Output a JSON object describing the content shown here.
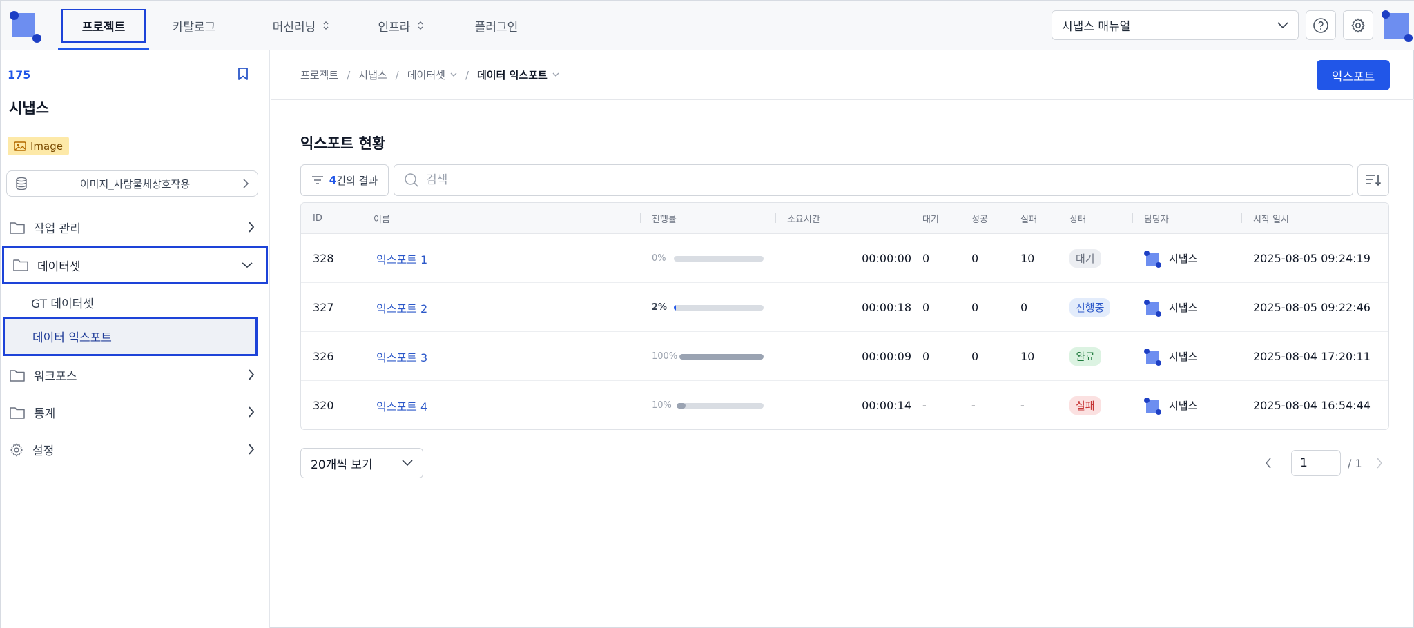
{
  "nav": {
    "tabs": [
      {
        "label": "프로젝트",
        "active": true
      },
      {
        "label": "카탈로그",
        "dropdown": false
      },
      {
        "label": "머신러닝",
        "dropdown": true
      },
      {
        "label": "인프라",
        "dropdown": true
      },
      {
        "label": "플러그인",
        "dropdown": false
      }
    ],
    "manual_select": "시냅스 매뉴얼",
    "icons": [
      "help-icon",
      "gear-icon",
      "avatar"
    ],
    "accent_color": "#2156e8"
  },
  "sidebar": {
    "project_id": "175",
    "project_name": "시냅스",
    "type_badge": "Image",
    "dataset_selector": "이미지_사람물체상호작용",
    "menu": [
      {
        "label": "작업 관리",
        "icon": "folder-icon",
        "expanded": false
      },
      {
        "label": "데이터셋",
        "icon": "folder-icon",
        "expanded": true
      },
      {
        "label": "워크포스",
        "icon": "folder-icon",
        "expanded": false
      },
      {
        "label": "통계",
        "icon": "folder-icon",
        "expanded": false
      },
      {
        "label": "설정",
        "icon": "gear-icon",
        "expanded": false
      }
    ],
    "submenu": [
      {
        "label": "GT 데이터셋",
        "active": false
      },
      {
        "label": "데이터 익스포트",
        "active": true
      }
    ]
  },
  "breadcrumb": [
    "프로젝트",
    "시냅스",
    "데이터셋",
    "데이터 익스포트"
  ],
  "export_button": "익스포트",
  "section_title": "익스포트 현황",
  "filter": {
    "count": "4",
    "suffix": "건의 결과"
  },
  "search": {
    "placeholder": "검색",
    "value": ""
  },
  "table": {
    "columns": [
      "ID",
      "이름",
      "진행률",
      "소요시간",
      "대기",
      "성공",
      "실패",
      "상태",
      "담당자",
      "시작 일시"
    ],
    "rows": [
      {
        "id": "328",
        "name": "익스포트 1",
        "progress_label": "0%",
        "progress": 0,
        "duration": "00:00:00",
        "wait": "0",
        "success": "0",
        "fail": "10",
        "status": "대기",
        "status_kind": "wait",
        "assignee": "시냅스",
        "started": "2025-08-05 09:24:19"
      },
      {
        "id": "327",
        "name": "익스포트 2",
        "progress_label": "2%",
        "progress": 2,
        "duration": "00:00:18",
        "wait": "0",
        "success": "0",
        "fail": "0",
        "status": "진행중",
        "status_kind": "run",
        "assignee": "시냅스",
        "started": "2025-08-05 09:22:46"
      },
      {
        "id": "326",
        "name": "익스포트 3",
        "progress_label": "100%",
        "progress": 100,
        "duration": "00:00:09",
        "wait": "0",
        "success": "0",
        "fail": "10",
        "status": "완료",
        "status_kind": "done",
        "assignee": "시냅스",
        "started": "2025-08-04 17:20:11"
      },
      {
        "id": "320",
        "name": "익스포트 4",
        "progress_label": "10%",
        "progress": 10,
        "duration": "00:00:14",
        "wait": "-",
        "success": "-",
        "fail": "-",
        "status": "실패",
        "status_kind": "fail",
        "assignee": "시냅스",
        "started": "2025-08-04 16:54:44"
      }
    ]
  },
  "pagination": {
    "page_size": "20개씩 보기",
    "current_page": "1",
    "total_pages": "/ 1"
  }
}
